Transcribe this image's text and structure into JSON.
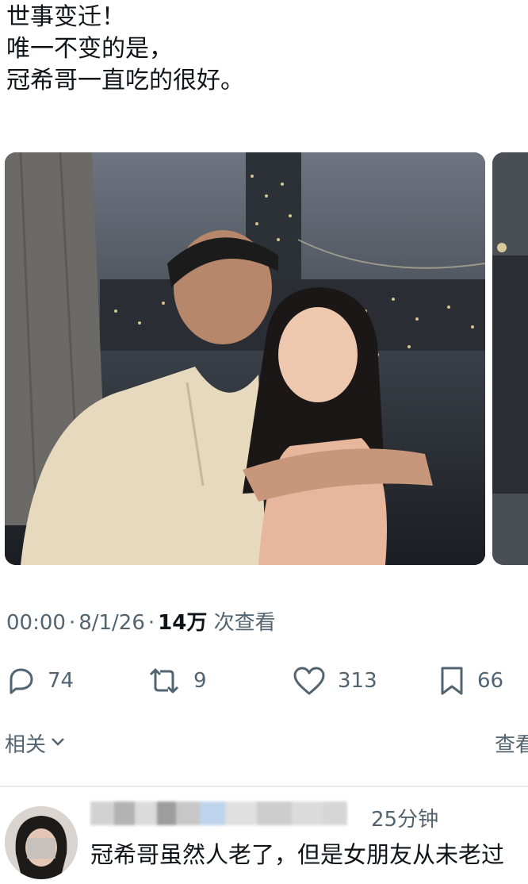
{
  "post": {
    "lines": [
      "世事变迁！",
      "唯一不变的是，",
      "冠希哥一直吃的很好。"
    ]
  },
  "meta": {
    "time": "00:00",
    "date": "8/1/26",
    "views_count": "14万",
    "views_label": "次查看"
  },
  "actions": {
    "replies": "74",
    "reposts": "9",
    "likes": "313",
    "bookmarks": "66"
  },
  "related": {
    "label": "相关",
    "more": "查看"
  },
  "reply": {
    "time": "25分钟",
    "text": "冠希哥虽然人老了，但是女朋友从未老过"
  },
  "colors": {
    "text_primary": "#0f1419",
    "text_secondary": "#536471",
    "divider": "#e8ebee"
  },
  "icons": [
    "reply-icon",
    "repost-icon",
    "like-icon",
    "bookmark-icon",
    "chevron-down-icon"
  ]
}
